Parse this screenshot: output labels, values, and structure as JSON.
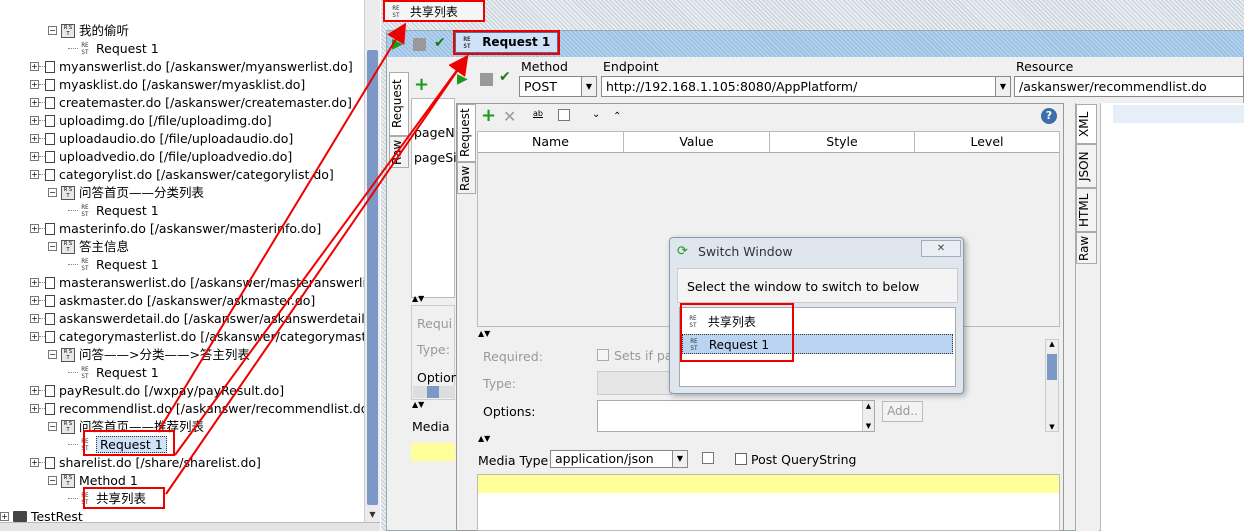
{
  "top_tab": {
    "label": "共享列表"
  },
  "request_tab": {
    "label": "Request 1"
  },
  "tree": {
    "items": [
      {
        "kind": "method",
        "text": "我的偷听"
      },
      {
        "kind": "request",
        "text": "Request 1"
      },
      {
        "kind": "resource",
        "text": "myanswerlist.do [/askanswer/myanswerlist.do]"
      },
      {
        "kind": "resource",
        "text": "myasklist.do [/askanswer/myasklist.do]"
      },
      {
        "kind": "resource",
        "text": "createmaster.do [/askanswer/createmaster.do]"
      },
      {
        "kind": "resource",
        "text": "uploadimg.do [/file/uploadimg.do]"
      },
      {
        "kind": "resource",
        "text": "uploadaudio.do [/file/uploadaudio.do]"
      },
      {
        "kind": "resource",
        "text": "uploadvedio.do [/file/uploadvedio.do]"
      },
      {
        "kind": "resource",
        "text": "categorylist.do [/askanswer/categorylist.do]"
      },
      {
        "kind": "method",
        "text": "问答首页——分类列表"
      },
      {
        "kind": "request",
        "text": "Request 1"
      },
      {
        "kind": "resource",
        "text": "masterinfo.do [/askanswer/masterinfo.do]"
      },
      {
        "kind": "method",
        "text": "答主信息"
      },
      {
        "kind": "request",
        "text": "Request 1"
      },
      {
        "kind": "resource",
        "text": "masteranswerlist.do [/askanswer/masteranswerlist.d"
      },
      {
        "kind": "resource",
        "text": "askmaster.do [/askanswer/askmaster.do]"
      },
      {
        "kind": "resource",
        "text": "askanswerdetail.do [/askanswer/askanswerdetail.do"
      },
      {
        "kind": "resource",
        "text": "categorymasterlist.do [/askanswer/categorymaster"
      },
      {
        "kind": "method",
        "text": "问答——>分类——>答主列表"
      },
      {
        "kind": "request",
        "text": "Request 1"
      },
      {
        "kind": "resource",
        "text": "payResult.do [/wxpay/payResult.do]"
      },
      {
        "kind": "resource",
        "text": "recommendlist.do [/askanswer/recommendlist.do]"
      },
      {
        "kind": "method",
        "text": "问答首页——推荐列表"
      },
      {
        "kind": "request",
        "text": "Request 1"
      },
      {
        "kind": "resource",
        "text": "sharelist.do [/share/sharelist.do]"
      },
      {
        "kind": "method",
        "text": "Method 1"
      },
      {
        "kind": "request",
        "text": "共享列表"
      },
      {
        "kind": "project",
        "text": "TestRest"
      }
    ]
  },
  "request": {
    "method_label": "Method",
    "method_value": "POST",
    "endpoint_label": "Endpoint",
    "endpoint_value": "http://192.168.1.105:8080/AppPlatform/",
    "resource_label": "Resource",
    "resource_value": "/askanswer/recommendlist.do"
  },
  "side_tabs": {
    "request": "Request",
    "raw": "Raw"
  },
  "back_params": [
    "pageN",
    "pageSi"
  ],
  "back_labels": {
    "required": "Requi",
    "type": "Type:",
    "options": "Option",
    "media": "Media"
  },
  "param_table": {
    "columns": [
      "Name",
      "Value",
      "Style",
      "Level"
    ]
  },
  "details": {
    "required_label": "Required:",
    "sets_if_label": "Sets if par",
    "type_label": "Type:",
    "options_label": "Options:",
    "add_button": "Add.."
  },
  "media": {
    "label": "Media Type",
    "value": "application/json",
    "post_qs_label": "Post QueryString"
  },
  "right_tabs": [
    "XML",
    "JSON",
    "HTML",
    "Raw"
  ],
  "dialog": {
    "title": "Switch Window",
    "close": "✕",
    "prompt": "Select the window to switch to below",
    "items": [
      "共享列表",
      "Request 1"
    ]
  },
  "colors": {
    "highlight": "#e00000",
    "selection": "#cfe2f7",
    "yellow": "#ffff99",
    "accent": "#3c6ea8"
  }
}
